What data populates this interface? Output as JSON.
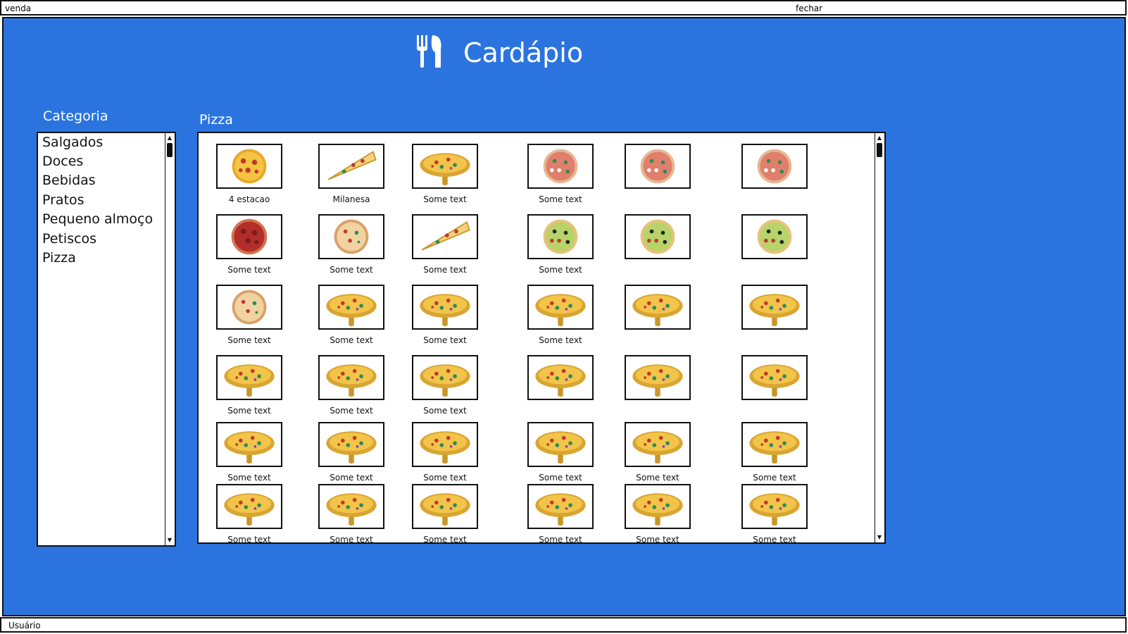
{
  "window": {
    "left_label": "venda",
    "right_label": "fechar"
  },
  "header": {
    "title": "Cardápio",
    "icon": "utensils-icon"
  },
  "sidebar": {
    "title": "Categoria",
    "items": [
      "Salgados",
      "Doces",
      "Bebidas",
      "Pratos",
      "Pequeno almoço",
      "Petiscos",
      "Pizza"
    ]
  },
  "content": {
    "title": "Pizza",
    "rows": [
      [
        {
          "caption": "4 estacao",
          "image": "pepperoni-pizza-image"
        },
        {
          "caption": "Milanesa",
          "image": "pizza-slice-image"
        },
        {
          "caption": "Some text",
          "image": "pizza-board-image"
        },
        {
          "caption": "Some text",
          "image": "veggie-pizza-image"
        },
        {
          "caption": "",
          "image": "veggie-pizza-image"
        },
        {
          "caption": "",
          "image": "veggie-pizza-image"
        }
      ],
      [
        {
          "caption": "Some text",
          "image": "salami-pizza-image"
        },
        {
          "caption": "Some text",
          "image": "cheese-pizza-image"
        },
        {
          "caption": "Some text",
          "image": "pizza-slice-image"
        },
        {
          "caption": "Some text",
          "image": "olive-pizza-image"
        },
        {
          "caption": "",
          "image": "olive-pizza-image"
        },
        {
          "caption": "",
          "image": "olive-pizza-image"
        }
      ],
      [
        {
          "caption": "Some text",
          "image": "cheese-pizza-image"
        },
        {
          "caption": "Some text",
          "image": "pizza-board-image"
        },
        {
          "caption": "Some text",
          "image": "pizza-board-image"
        },
        {
          "caption": "Some text",
          "image": "pizza-board-image"
        },
        {
          "caption": "",
          "image": "pizza-board-image"
        },
        {
          "caption": "",
          "image": "pizza-board-image"
        }
      ],
      [
        {
          "caption": "Some text",
          "image": "pizza-board-image"
        },
        {
          "caption": "Some text",
          "image": "pizza-board-image"
        },
        {
          "caption": "Some text",
          "image": "pizza-board-image"
        },
        {
          "caption": "",
          "image": "pizza-board-image"
        },
        {
          "caption": "",
          "image": "pizza-board-image"
        },
        {
          "caption": "",
          "image": "pizza-board-image"
        }
      ],
      [
        {
          "caption": "Some text",
          "image": "pizza-board-image"
        },
        {
          "caption": "Some text",
          "image": "pizza-board-image"
        },
        {
          "caption": "Some text",
          "image": "pizza-board-image"
        },
        {
          "caption": "Some text",
          "image": "pizza-board-image"
        },
        {
          "caption": "Some text",
          "image": "pizza-board-image"
        },
        {
          "caption": "Some text",
          "image": "pizza-board-image"
        }
      ],
      [
        {
          "caption": "Some text",
          "image": "pizza-board-image"
        },
        {
          "caption": "Some text",
          "image": "pizza-board-image"
        },
        {
          "caption": "Some text",
          "image": "pizza-board-image"
        },
        {
          "caption": "Some text",
          "image": "pizza-board-image"
        },
        {
          "caption": "Some text",
          "image": "pizza-board-image"
        },
        {
          "caption": "Some text",
          "image": "pizza-board-image"
        }
      ]
    ]
  },
  "status": {
    "user_label": "Usuário"
  },
  "colors": {
    "background": "#2b74e0",
    "panel": "#ffffff",
    "border": "#111111"
  }
}
